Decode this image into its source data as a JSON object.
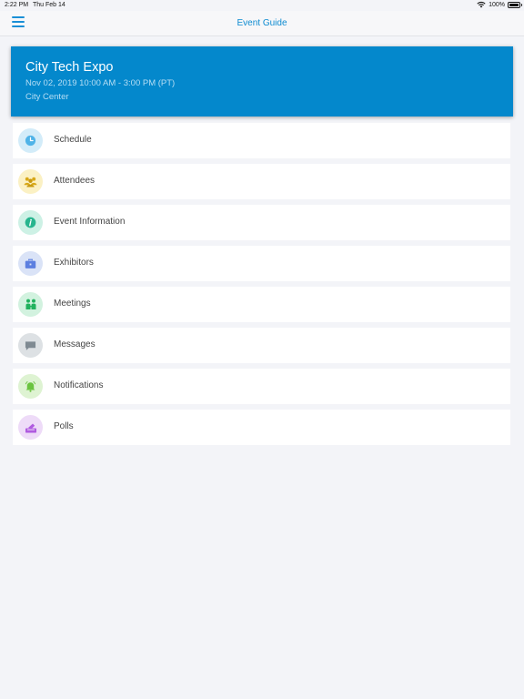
{
  "status_bar": {
    "time": "2:22 PM",
    "date": "Thu Feb 14",
    "battery": "100%"
  },
  "nav": {
    "title": "Event Guide",
    "menu_icon": "hamburger-icon"
  },
  "event": {
    "name": "City Tech Expo",
    "datetime": "Nov 02, 2019 10:00 AM - 3:00 PM (PT)",
    "venue": "City Center",
    "color": "#0488cc"
  },
  "menu": {
    "items": [
      {
        "label": "Schedule",
        "icon": "clock-icon",
        "color": "#4fb3e8",
        "bg": "#d3ecf9"
      },
      {
        "label": "Attendees",
        "icon": "people-icon",
        "color": "#d8a817",
        "bg": "#fbf1c4"
      },
      {
        "label": "Event Information",
        "icon": "info-icon",
        "color": "#27b58e",
        "bg": "#cdf1e5"
      },
      {
        "label": "Exhibitors",
        "icon": "briefcase-icon",
        "color": "#5c7fe0",
        "bg": "#dae3f7"
      },
      {
        "label": "Meetings",
        "icon": "meeting-icon",
        "color": "#21b25e",
        "bg": "#d2f2df"
      },
      {
        "label": "Messages",
        "icon": "message-icon",
        "color": "#7f8a92",
        "bg": "#dde1e4"
      },
      {
        "label": "Notifications",
        "icon": "bell-icon",
        "color": "#6bc43f",
        "bg": "#def3d2"
      },
      {
        "label": "Polls",
        "icon": "ballot-icon",
        "color": "#b05be0",
        "bg": "#eedbf8"
      }
    ]
  }
}
